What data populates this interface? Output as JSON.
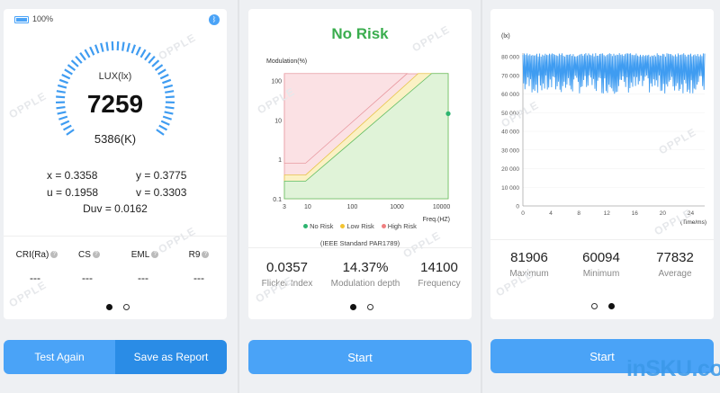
{
  "panel1": {
    "battery": "100%",
    "lux_label": "LUX(lx)",
    "lux_value": "7259",
    "cct": "5386(K)",
    "coords": {
      "x": "x = 0.3358",
      "y": "y = 0.3775",
      "u": "u = 0.1958",
      "v": "v = 0.3303",
      "duv": "Duv = 0.0162"
    },
    "metrics": [
      {
        "label": "CRI(Ra)",
        "value": "---"
      },
      {
        "label": "CS",
        "value": "---"
      },
      {
        "label": "EML",
        "value": "---"
      },
      {
        "label": "R9",
        "value": "---"
      }
    ],
    "buttons": {
      "test_again": "Test Again",
      "save_report": "Save as Report"
    }
  },
  "panel2": {
    "title": "No Risk",
    "chart_data": {
      "type": "area",
      "ylabel": "Modulation(%)",
      "xlabel": "Freq.(HZ)",
      "x_ticks": [
        "3",
        "10",
        "100",
        "1000",
        "10000"
      ],
      "y_ticks": [
        "100",
        "10",
        "1",
        "0.1"
      ],
      "regions": [
        "No Risk",
        "Low Risk",
        "High Risk"
      ],
      "point": {
        "freq": 14100,
        "modulation": 14.37
      },
      "standard": "(IEEE Standard PAR1789)"
    },
    "legend": [
      "No Risk",
      "Low Risk",
      "High Risk"
    ],
    "legend_colors": [
      "#2db46f",
      "#f3c431",
      "#ef7f80"
    ],
    "metrics": [
      {
        "value": "0.0357",
        "label": "Flicker Index"
      },
      {
        "value": "14.37%",
        "label": "Modulation depth"
      },
      {
        "value": "14100",
        "label": "Frequency"
      }
    ],
    "start": "Start"
  },
  "panel3": {
    "chart_data": {
      "type": "line",
      "ylabel": "(lx)",
      "xlabel": "(Time/ms)",
      "y_ticks": [
        "80 000",
        "70 000",
        "60 000",
        "50 000",
        "40 000",
        "30 000",
        "20 000",
        "10 000",
        "0"
      ],
      "x_ticks": [
        "0",
        "4",
        "8",
        "12",
        "16",
        "20",
        "24"
      ],
      "ylim": [
        0,
        80000
      ],
      "xlim": [
        0,
        26
      ],
      "max": 81906,
      "min": 60094,
      "avg": 77832
    },
    "metrics": [
      {
        "value": "81906",
        "label": "Maximum"
      },
      {
        "value": "60094",
        "label": "Minimum"
      },
      {
        "value": "77832",
        "label": "Average"
      }
    ],
    "start": "Start"
  },
  "watermark": "OPPLE",
  "brand": "inSKU.com"
}
